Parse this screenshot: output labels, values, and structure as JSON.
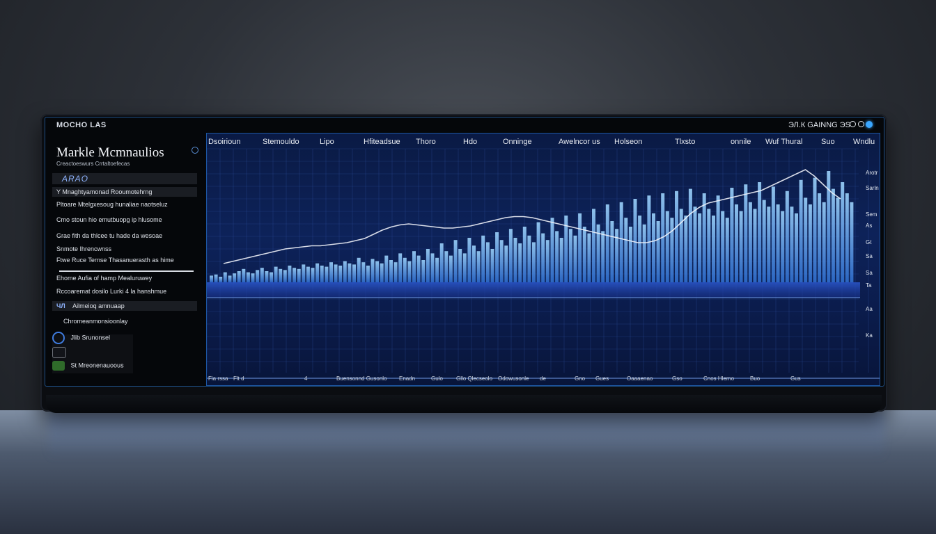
{
  "window": {
    "title": "MOCHO LAS",
    "status_text": "ЭЛ.К GAINNG ЭS"
  },
  "sidebar": {
    "title": "Markle Mcmnaulios",
    "subtitle": "Creactoeswurs Crrtaltoefecas",
    "search_label": "ARAO",
    "items": [
      {
        "label": "Y Mnaghtyamonad Rooumotehrng"
      },
      {
        "label": "Pltoare Mtelgxesoug hunaliae naotseluz"
      },
      {
        "label": "Cmo stoun hio emutbuopg ip hlusome"
      },
      {
        "label": "Grae fith da thlcee tu hade da wesoae"
      },
      {
        "label": "Snmote Ihrencwnss"
      },
      {
        "label": "Ftwe Ruce Ternse Thasanuerasth as hime"
      },
      {
        "label": "Ehome Aufia of hamp Mealuruwey"
      },
      {
        "label": "Rccoaremat dosilo Lurki 4 la hanshmue"
      },
      {
        "label": "Ailmeioq amnuaap"
      },
      {
        "label": "Chromeanmonsioonlay"
      },
      {
        "label": "Jlib Srunonsel"
      },
      {
        "label": "St Mreonenauoous"
      }
    ],
    "hl_icon_text": "ЧЛ"
  },
  "chart": {
    "headers": [
      "Dsoirioun",
      "Stemouldo",
      "Lipo",
      "Hfiteadsue",
      "Thoro",
      "Hdo",
      "Onninge",
      "Awelncor us",
      "Holseon",
      "Tlxsto",
      "onnile",
      "Wuf Thural",
      "Suo",
      "Wndlu"
    ],
    "x_ticks": [
      "Fia rssa",
      "Flt d",
      "4",
      "Buensonnd Gusonlo",
      "Enadn",
      "Gulo",
      "Gllo Qlecseolo",
      "Odowusonle",
      "de",
      "Gno",
      "Gues",
      "Oaaaenao",
      "Gso",
      "Cnos Hlemo",
      "Buo",
      "Gus"
    ],
    "y_ticks": [
      "Arotr",
      "Sarln",
      "Sem",
      "As",
      "Gt",
      "Sa",
      "Sa",
      "Ta",
      "Aa",
      "Ka"
    ]
  },
  "chart_data": {
    "type": "bar",
    "title": "",
    "xlabel": "",
    "ylabel": "",
    "series": [
      {
        "values": [
          6,
          7,
          5,
          9,
          6,
          8,
          10,
          12,
          9,
          8,
          11,
          13,
          10,
          9,
          14,
          12,
          11,
          15,
          13,
          12,
          16,
          14,
          13,
          17,
          15,
          14,
          18,
          16,
          15,
          19,
          17,
          16,
          22,
          18,
          15,
          21,
          19,
          17,
          24,
          20,
          18,
          26,
          22,
          19,
          28,
          24,
          20,
          30,
          26,
          22,
          35,
          28,
          24,
          38,
          30,
          26,
          40,
          33,
          28,
          42,
          36,
          30,
          45,
          38,
          33,
          48,
          40,
          35,
          50,
          42,
          36,
          54,
          44,
          38,
          58,
          46,
          40,
          60,
          48,
          42,
          62,
          50,
          44,
          66,
          52,
          46,
          70,
          55,
          48,
          72,
          58,
          50,
          75,
          60,
          52,
          78,
          62,
          55,
          80,
          64,
          58,
          82,
          66,
          60,
          84,
          68,
          62,
          80,
          66,
          60,
          78,
          64,
          58,
          85,
          70,
          64,
          88,
          72,
          66,
          90,
          74,
          68,
          86,
          70,
          64,
          82,
          68,
          62,
          92,
          76,
          70,
          94,
          80,
          72,
          100,
          84,
          76,
          90,
          80,
          72
        ]
      },
      {
        "values": [
          10,
          12,
          14,
          16,
          18,
          20,
          22,
          24,
          25,
          26,
          27,
          27,
          28,
          29,
          30,
          32,
          34,
          38,
          42,
          45,
          47,
          48,
          47,
          46,
          45,
          44,
          44,
          45,
          46,
          48,
          50,
          52,
          54,
          55,
          55,
          54,
          52,
          50,
          48,
          46,
          44,
          42,
          40,
          38,
          36,
          34,
          32,
          30,
          30,
          32,
          36,
          42,
          50,
          58,
          64,
          68,
          70,
          72,
          74,
          76,
          78,
          80,
          84,
          88,
          92,
          96,
          100,
          94,
          86,
          78,
          72
        ]
      }
    ]
  },
  "colors": {
    "accent": "#3aa6ff",
    "bar_fill": "#5ab6ff",
    "line": "#e6e9f2",
    "chart_bg": "#0d2259"
  }
}
